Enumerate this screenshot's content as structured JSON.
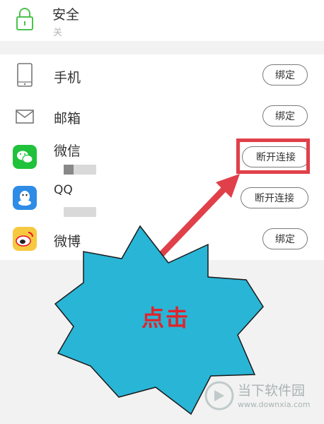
{
  "security": {
    "label": "安全",
    "status": "关"
  },
  "rows": [
    {
      "label": "手机",
      "button": "绑定"
    },
    {
      "label": "邮箱",
      "button": "绑定"
    },
    {
      "label": "微信",
      "button": "断开连接"
    },
    {
      "label": "QQ",
      "button": "断开连接"
    },
    {
      "label": "微博",
      "button": "绑定"
    }
  ],
  "annotation": {
    "text": "点击",
    "color": "#e0242b",
    "highlight_color": "#e0404a"
  },
  "watermark": {
    "brand": "当下软件园",
    "url": "www.downxia.com"
  },
  "colors": {
    "lock_green": "#4cc24c",
    "wechat_green": "#1fc23a",
    "qq_blue": "#2e8ce6",
    "weibo_red": "#e6162d",
    "burst_fill": "#29b5d6"
  }
}
